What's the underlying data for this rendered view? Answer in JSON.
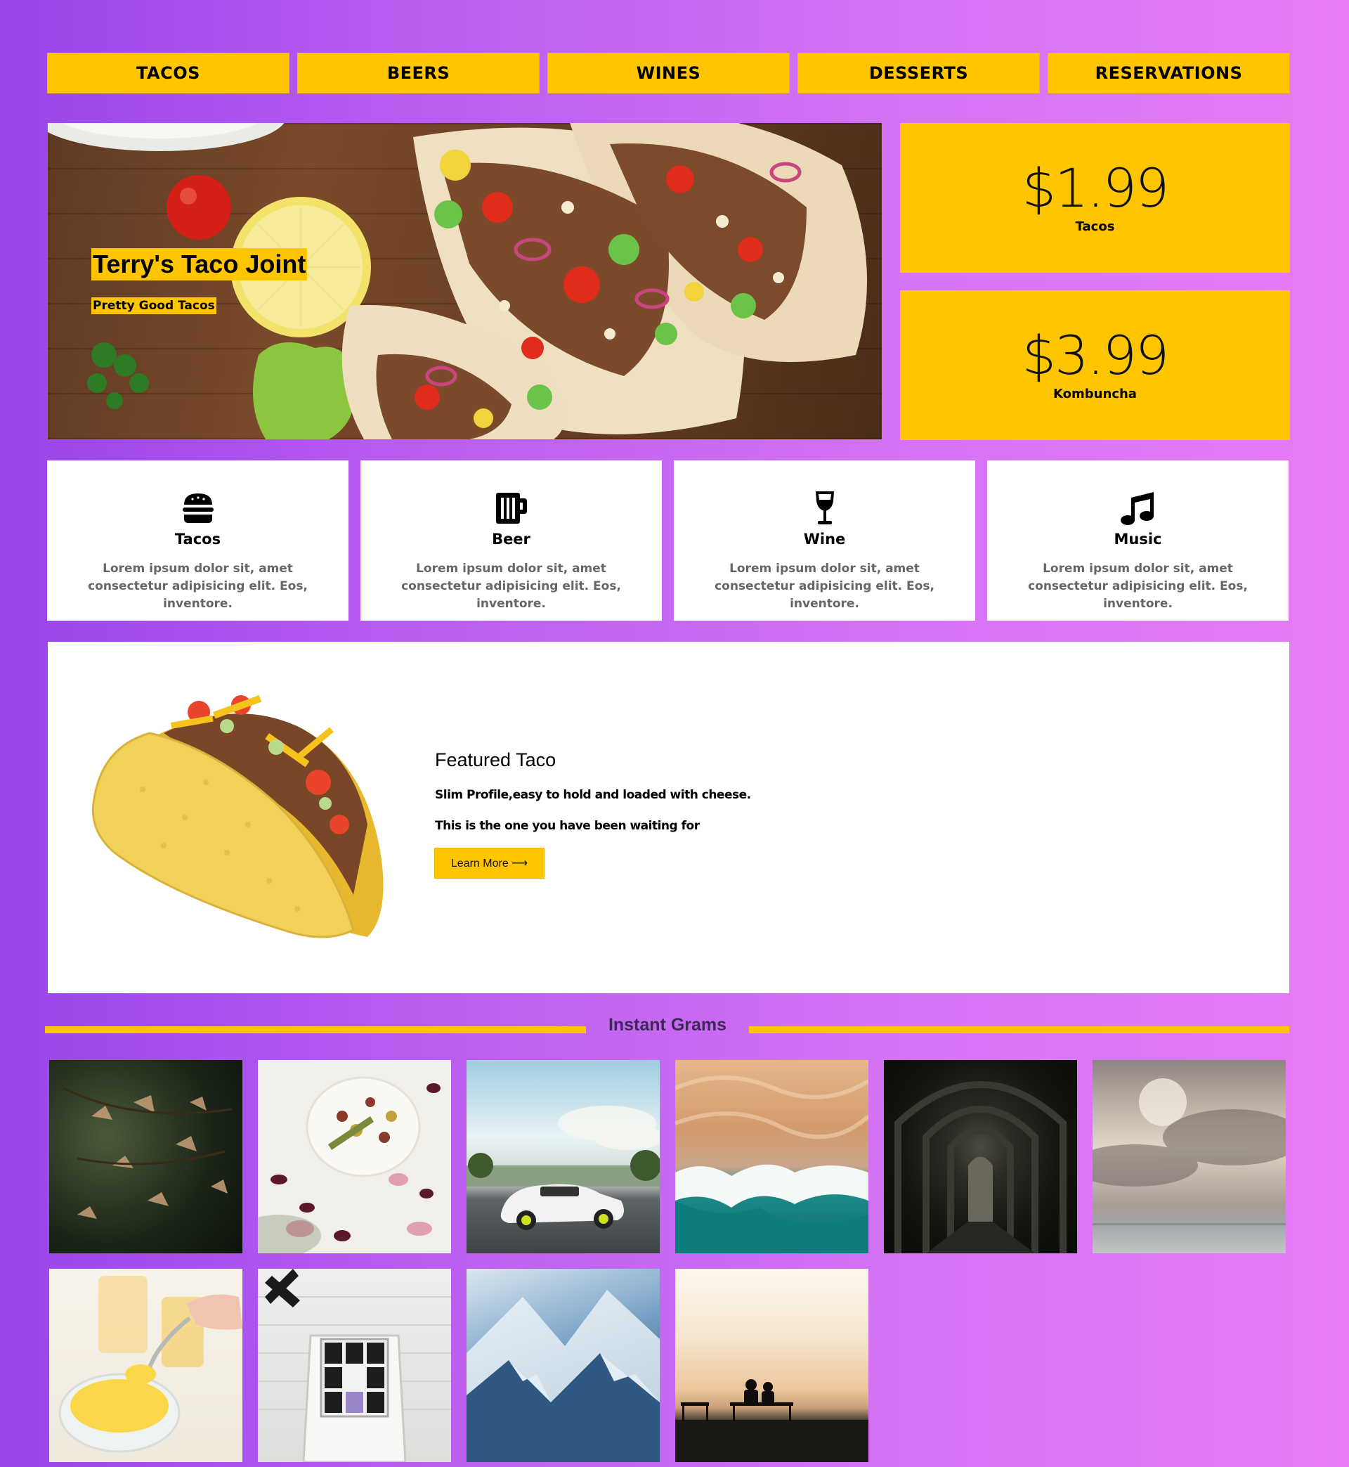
{
  "nav": {
    "items": [
      {
        "label": "TACOS"
      },
      {
        "label": "BEERS"
      },
      {
        "label": "WINES"
      },
      {
        "label": "DESSERTS"
      },
      {
        "label": "RESERVATIONS"
      }
    ]
  },
  "hero": {
    "title": "Terry's Taco Joint",
    "subtitle": "Pretty Good Tacos"
  },
  "prices": [
    {
      "amount": "$1.99",
      "label": "Tacos"
    },
    {
      "amount": "$3.99",
      "label": "Kombuncha"
    }
  ],
  "features": [
    {
      "icon": "hamburger-icon",
      "title": "Tacos",
      "text": "Lorem ipsum dolor sit, amet consectetur adipisicing elit. Eos, inventore."
    },
    {
      "icon": "beer-mug-icon",
      "title": "Beer",
      "text": "Lorem ipsum dolor sit, amet consectetur adipisicing elit. Eos, inventore."
    },
    {
      "icon": "wine-glass-icon",
      "title": "Wine",
      "text": "Lorem ipsum dolor sit, amet consectetur adipisicing elit. Eos, inventore."
    },
    {
      "icon": "music-note-icon",
      "title": "Music",
      "text": "Lorem ipsum dolor sit, amet consectetur adipisicing elit. Eos, inventore."
    }
  ],
  "featured": {
    "title": "Featured Taco",
    "line1": "Slim Profile,easy to hold and loaded with cheese.",
    "line2": "This is the one you have been waiting for",
    "button_label": "Learn More ⟶"
  },
  "grams": {
    "title": "Instant Grams"
  },
  "colors": {
    "accent": "#ffc600",
    "gradient_start": "#9a45ea",
    "gradient_end": "#e77cf5",
    "card_text": "#666666"
  }
}
